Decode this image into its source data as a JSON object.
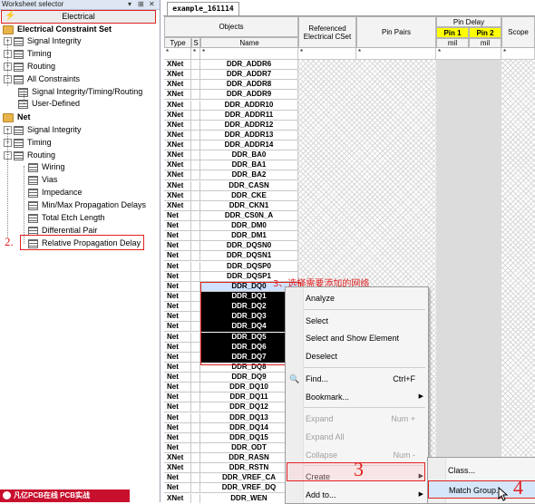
{
  "left_panel": {
    "title": "Worksheet selector",
    "controls": [
      "▾",
      "⊞",
      "✕"
    ],
    "electrical_label": "Electrical",
    "tree": [
      {
        "label": "Electrical Constraint Set",
        "kind": "section"
      },
      {
        "label": "Signal Integrity",
        "kind": "folder"
      },
      {
        "label": "Timing",
        "kind": "folder"
      },
      {
        "label": "Routing",
        "kind": "folder"
      },
      {
        "label": "All Constraints",
        "kind": "folder-open"
      },
      {
        "label": "Signal Integrity/Timing/Routing",
        "kind": "sheet"
      },
      {
        "label": "User-Defined",
        "kind": "sheet"
      },
      {
        "label": "Net",
        "kind": "section"
      },
      {
        "label": "Signal Integrity",
        "kind": "folder"
      },
      {
        "label": "Timing",
        "kind": "folder"
      },
      {
        "label": "Routing",
        "kind": "folder-open"
      },
      {
        "label": "Wiring",
        "kind": "sheet"
      },
      {
        "label": "Vias",
        "kind": "sheet"
      },
      {
        "label": "Impedance",
        "kind": "sheet"
      },
      {
        "label": "Min/Max Propagation Delays",
        "kind": "sheet"
      },
      {
        "label": "Total Etch Length",
        "kind": "sheet"
      },
      {
        "label": "Differential Pair",
        "kind": "sheet"
      },
      {
        "label": "Relative Propagation Delay",
        "kind": "sheet"
      }
    ],
    "step2": "2.",
    "logo_text": "凡亿PCB在线 PCB实战"
  },
  "worksheet": {
    "tab": "example_161114",
    "headers": {
      "objects": "Objects",
      "type": "Type",
      "s": "S",
      "name": "Name",
      "ref_cset": "Referenced Electrical CSet",
      "pin_pairs": "Pin Pairs",
      "pin_delay": "Pin Delay",
      "pin1": "Pin 1",
      "pin2": "Pin 2",
      "unit1": "mil",
      "unit2": "mil",
      "scope": "Scope"
    },
    "filter_row": [
      "*",
      "*",
      "*",
      "*",
      "*",
      "*",
      "*"
    ],
    "rows": [
      {
        "type": "XNet",
        "name": "DDR_ADDR6"
      },
      {
        "type": "XNet",
        "name": "DDR_ADDR7"
      },
      {
        "type": "XNet",
        "name": "DDR_ADDR8"
      },
      {
        "type": "XNet",
        "name": "DDR_ADDR9"
      },
      {
        "type": "XNet",
        "name": "DDR_ADDR10"
      },
      {
        "type": "XNet",
        "name": "DDR_ADDR11"
      },
      {
        "type": "XNet",
        "name": "DDR_ADDR12"
      },
      {
        "type": "XNet",
        "name": "DDR_ADDR13"
      },
      {
        "type": "XNet",
        "name": "DDR_ADDR14"
      },
      {
        "type": "XNet",
        "name": "DDR_BA0"
      },
      {
        "type": "XNet",
        "name": "DDR_BA1"
      },
      {
        "type": "XNet",
        "name": "DDR_BA2"
      },
      {
        "type": "XNet",
        "name": "DDR_CASN"
      },
      {
        "type": "XNet",
        "name": "DDR_CKE"
      },
      {
        "type": "XNet",
        "name": "DDR_CKN1"
      },
      {
        "type": "Net",
        "name": "DDR_CS0N_A"
      },
      {
        "type": "Net",
        "name": "DDR_DM0"
      },
      {
        "type": "Net",
        "name": "DDR_DM1"
      },
      {
        "type": "Net",
        "name": "DDR_DQSN0"
      },
      {
        "type": "Net",
        "name": "DDR_DQSN1"
      },
      {
        "type": "Net",
        "name": "DDR_DQSP0"
      },
      {
        "type": "Net",
        "name": "DDR_DQSP1"
      },
      {
        "type": "Net",
        "name": "DDR_DQ0",
        "sel": "first"
      },
      {
        "type": "Net",
        "name": "DDR_DQ1",
        "sel": "black"
      },
      {
        "type": "Net",
        "name": "DDR_DQ2",
        "sel": "black"
      },
      {
        "type": "Net",
        "name": "DDR_DQ3",
        "sel": "black"
      },
      {
        "type": "Net",
        "name": "DDR_DQ4",
        "sel": "black"
      },
      {
        "type": "Net",
        "name": "DDR_DQ5",
        "sel": "black"
      },
      {
        "type": "Net",
        "name": "DDR_DQ6",
        "sel": "black"
      },
      {
        "type": "Net",
        "name": "DDR_DQ7",
        "sel": "black"
      },
      {
        "type": "Net",
        "name": "DDR_DQ8"
      },
      {
        "type": "Net",
        "name": "DDR_DQ9"
      },
      {
        "type": "Net",
        "name": "DDR_DQ10"
      },
      {
        "type": "Net",
        "name": "DDR_DQ11"
      },
      {
        "type": "Net",
        "name": "DDR_DQ12"
      },
      {
        "type": "Net",
        "name": "DDR_DQ13"
      },
      {
        "type": "Net",
        "name": "DDR_DQ14"
      },
      {
        "type": "Net",
        "name": "DDR_DQ15"
      },
      {
        "type": "Net",
        "name": "DDR_ODT"
      },
      {
        "type": "XNet",
        "name": "DDR_RASN"
      },
      {
        "type": "XNet",
        "name": "DDR_RSTN"
      },
      {
        "type": "Net",
        "name": "DDR_VREF_CA"
      },
      {
        "type": "Net",
        "name": "DDR_VREF_DQ"
      },
      {
        "type": "XNet",
        "name": "DDR_WEN"
      }
    ],
    "annotation3": "3、选择需要添加的网络"
  },
  "context_menu": {
    "items": [
      {
        "label": "Analyze",
        "u": "A"
      },
      {
        "sep": true
      },
      {
        "label": "Select",
        "u": "S"
      },
      {
        "label": "Select and Show Element"
      },
      {
        "label": "Deselect"
      },
      {
        "sep": true
      },
      {
        "label": "Find...",
        "shortcut": "Ctrl+F",
        "icon": true
      },
      {
        "label": "Bookmark...",
        "submenu": true
      },
      {
        "sep": true
      },
      {
        "label": "Expand",
        "shortcut": "Num +",
        "disabled": true
      },
      {
        "label": "Expand All",
        "disabled": true
      },
      {
        "label": "Collapse",
        "shortcut": "Num -",
        "disabled": true
      },
      {
        "sep": true
      },
      {
        "label": "Create",
        "submenu": true,
        "highlight": true
      },
      {
        "label": "Add to...",
        "submenu": true
      }
    ],
    "step3": "3",
    "submenu": {
      "items": [
        {
          "label": "Class..."
        },
        {
          "label": "Match Group...",
          "highlight": true
        }
      ],
      "step4": "4"
    }
  }
}
